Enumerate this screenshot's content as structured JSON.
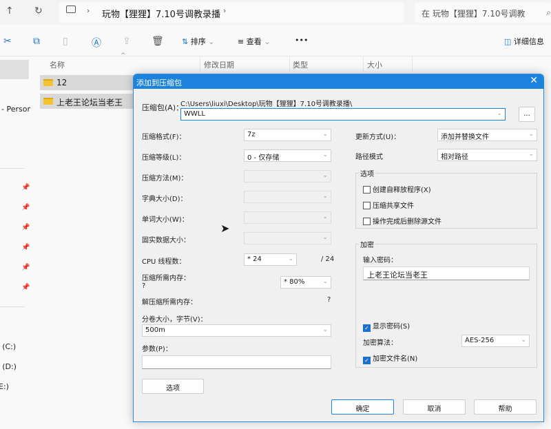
{
  "explorer": {
    "breadcrumb": "玩物【狸狸】7.10号调教录播",
    "search_placeholder": "在 玩物【狸狸】7.10号调教",
    "toolbar": {
      "sort": "排序",
      "view": "查看",
      "more": "•••",
      "details": "详细信息"
    },
    "columns": [
      "名称",
      "修改日期",
      "类型",
      "大小"
    ],
    "files": [
      {
        "name": "12"
      },
      {
        "name": "上老王论坛当老王"
      }
    ],
    "sidebar": {
      "onedrive": "- Persor",
      "drives": [
        ": (C:)",
        ": (D:)",
        "E:)"
      ]
    }
  },
  "dialog": {
    "title": "添加到压缩包",
    "archive_label": "压缩包(A)：",
    "archive_path": "C:\\Users\\liuxi\\Desktop\\玩物【狸狸】7.10号调教录播\\",
    "archive_name": "WWLL",
    "browse": "...",
    "left": [
      {
        "label": "压缩格式(F)：",
        "value": "7z",
        "enabled": true
      },
      {
        "label": "压缩等级(L)：",
        "value": "0 - 仅存储",
        "enabled": true
      },
      {
        "label": "压缩方法(M)：",
        "value": "",
        "enabled": false
      },
      {
        "label": "字典大小(D)：",
        "value": "",
        "enabled": false
      },
      {
        "label": "单词大小(W)：",
        "value": "",
        "enabled": false
      },
      {
        "label": "固实数据大小：",
        "value": "",
        "enabled": false
      }
    ],
    "cpu_label": "CPU 线程数：",
    "cpu_value": "* 24",
    "cpu_max": "/ 24",
    "mem_label": "压缩所需内存：",
    "mem_q": "?",
    "mem_value": "* 80%",
    "decomp_label": "解压缩所需内存：",
    "decomp_q": "?",
    "volume_label": "分卷大小，字节(V)：",
    "volume_value": "500m",
    "params_label": "参数(P)：",
    "params_value": "",
    "options_button": "选项",
    "update_label": "更新方式(U)：",
    "update_value": "添加并替换文件",
    "pathmode_label": "路径模式",
    "pathmode_value": "相对路径",
    "options_group": "选项",
    "options": [
      {
        "label": "创建自释放程序(X)",
        "checked": false
      },
      {
        "label": "压缩共享文件",
        "checked": false
      },
      {
        "label": "操作完成后删除源文件",
        "checked": false
      }
    ],
    "enc_group": "加密",
    "password_label": "输入密码：",
    "password_value": "上老王论坛当老王",
    "show_password": {
      "label": "显示密码(S)",
      "checked": true
    },
    "enc_method_label": "加密算法：",
    "enc_method_value": "AES-256",
    "enc_names": {
      "label": "加密文件名(N)",
      "checked": true
    },
    "ok": "确定",
    "cancel": "取消",
    "help": "帮助"
  }
}
